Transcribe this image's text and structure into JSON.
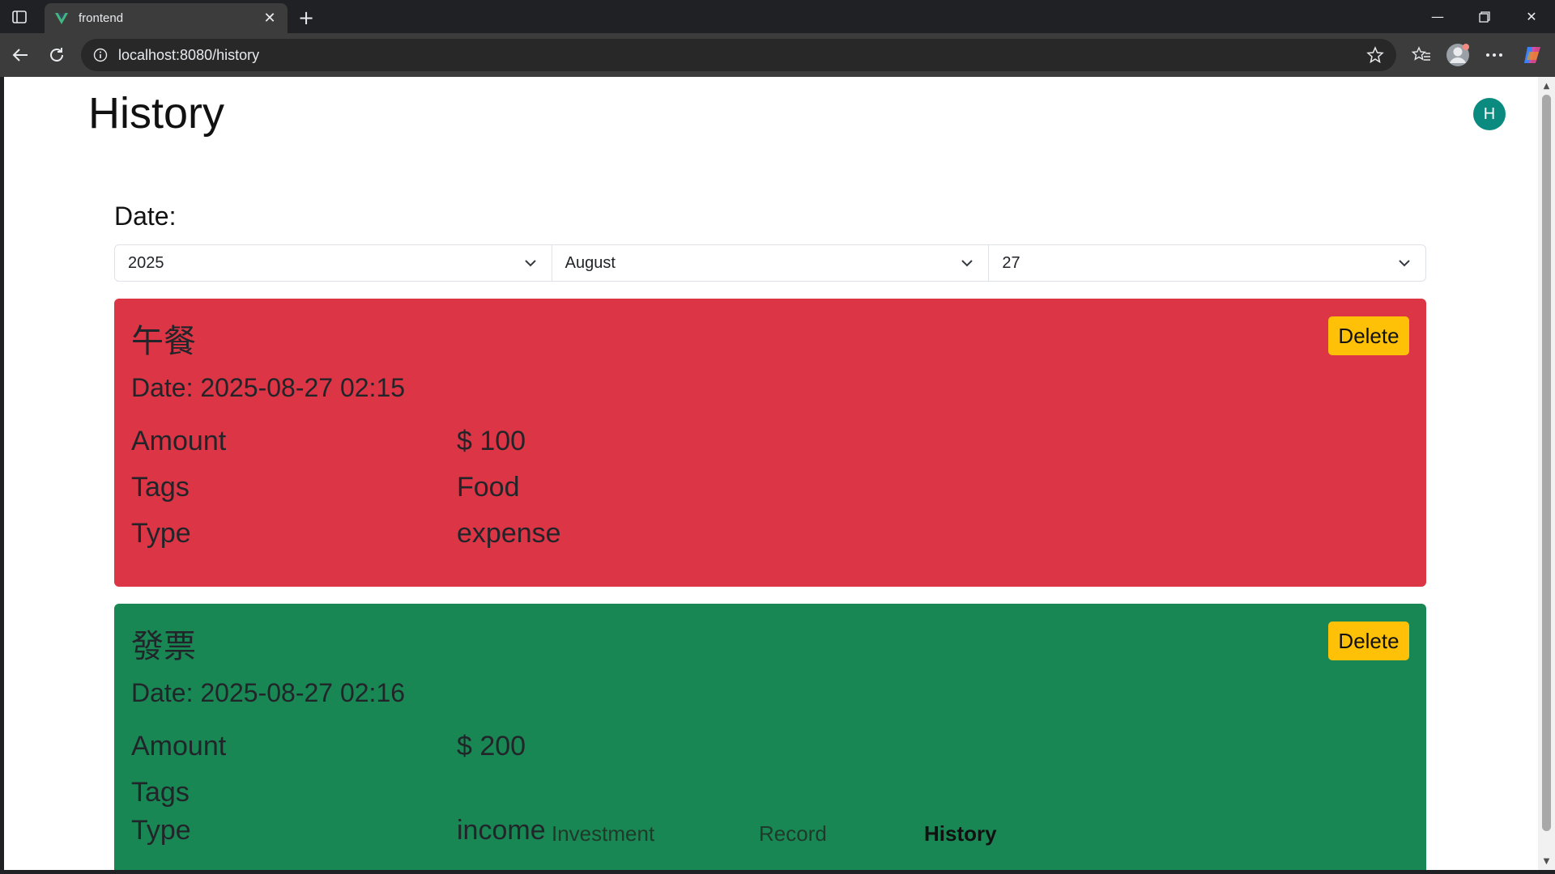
{
  "browser": {
    "tab_title": "frontend",
    "url": "localhost:8080/history"
  },
  "page": {
    "title": "History",
    "avatar_letter": "H",
    "date_label": "Date:"
  },
  "filters": {
    "year": "2025",
    "month": "August",
    "day": "27"
  },
  "records": [
    {
      "title": "午餐",
      "date": "Date: 2025-08-27 02:15",
      "amount_label": "Amount",
      "amount": "$ 100",
      "tags_label": "Tags",
      "tags": "Food",
      "type_label": "Type",
      "type": "expense",
      "delete_label": "Delete",
      "color": "#dc3545"
    },
    {
      "title": "發票",
      "date": "Date: 2025-08-27 02:16",
      "amount_label": "Amount",
      "amount": "$ 200",
      "tags_label": "Tags",
      "tags": "",
      "type_label": "Type",
      "type": "income",
      "delete_label": "Delete",
      "color": "#198754"
    }
  ],
  "bottom_nav": {
    "investment": "Investment",
    "record": "Record",
    "history": "History"
  },
  "colors": {
    "accent_button": "#ffc107",
    "avatar_bg": "#0b8a80"
  }
}
